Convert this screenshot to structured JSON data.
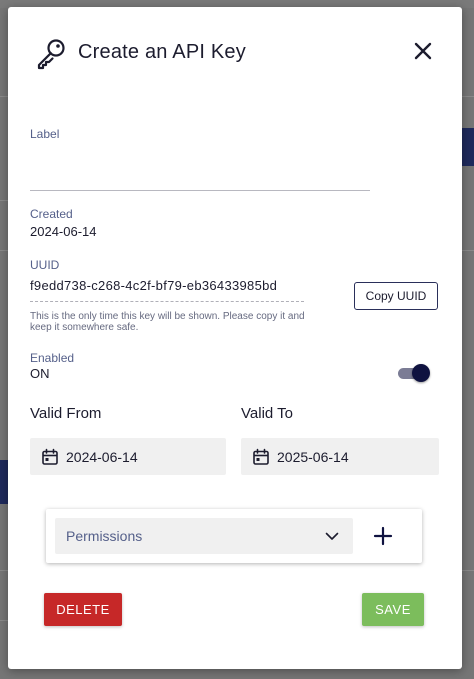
{
  "dialog": {
    "title": "Create an API Key",
    "icon": "key-icon",
    "close_icon": "close-icon"
  },
  "form": {
    "label_field": {
      "label": "Label",
      "value": "",
      "placeholder": ""
    },
    "created": {
      "label": "Created",
      "value": "2024-06-14"
    },
    "uuid": {
      "label": "UUID",
      "value": "f9edd738-c268-4c2f-bf79-eb36433985bd",
      "hint": "This is the only time this key will be shown. Please copy it and keep it somewhere safe.",
      "copy_label": "Copy UUID"
    },
    "enabled": {
      "label": "Enabled",
      "value": "ON",
      "toggle_on": true
    },
    "valid_from": {
      "label": "Valid From",
      "value": "2024-06-14",
      "icon": "calendar-icon"
    },
    "valid_to": {
      "label": "Valid To",
      "value": "2025-06-14",
      "icon": "calendar-icon"
    },
    "permissions": {
      "placeholder": "Permissions",
      "dropdown_icon": "chevron-down-icon",
      "add_icon": "plus-icon"
    }
  },
  "actions": {
    "delete_label": "DELETE",
    "save_label": "SAVE"
  },
  "colors": {
    "accent_navy": "#0f1240",
    "delete_red": "#c62828",
    "save_green": "#7cbd5c"
  }
}
